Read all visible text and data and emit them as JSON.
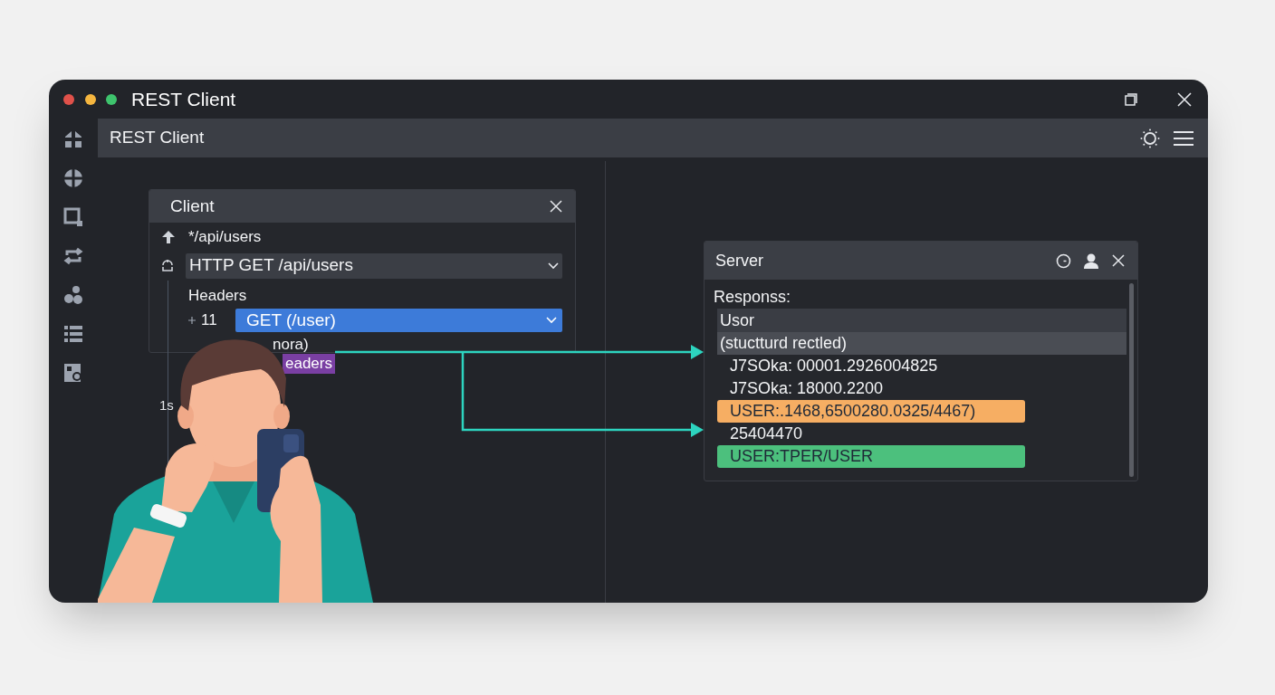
{
  "window": {
    "title": "REST Client"
  },
  "header": {
    "title": "REST Client"
  },
  "client_panel": {
    "title": "Client",
    "path": "*/api/users",
    "request": "HTTP GET /api/users",
    "headers_label": "Headers",
    "row_number": "11",
    "method": "GET (/user)",
    "partial_text": "nora)",
    "tag": "eaders",
    "side_text": "1s"
  },
  "server_panel": {
    "title": "Server",
    "label": "Responss:",
    "rows": [
      {
        "kind": "header",
        "text": "Usor"
      },
      {
        "kind": "subheader",
        "text": "(stuctturd rectled)"
      },
      {
        "kind": "line",
        "text": "J7SOka: 00001.2926004825"
      },
      {
        "kind": "line",
        "text": "J7SOka: 18000.2200"
      },
      {
        "kind": "badge",
        "text": "USER:.1468,6500280.0325/4467)",
        "color": "#f6ae63"
      },
      {
        "kind": "line",
        "text": "25404470"
      },
      {
        "kind": "badge",
        "text": "USER:TPER/USER",
        "color": "#4cc07d"
      }
    ]
  }
}
